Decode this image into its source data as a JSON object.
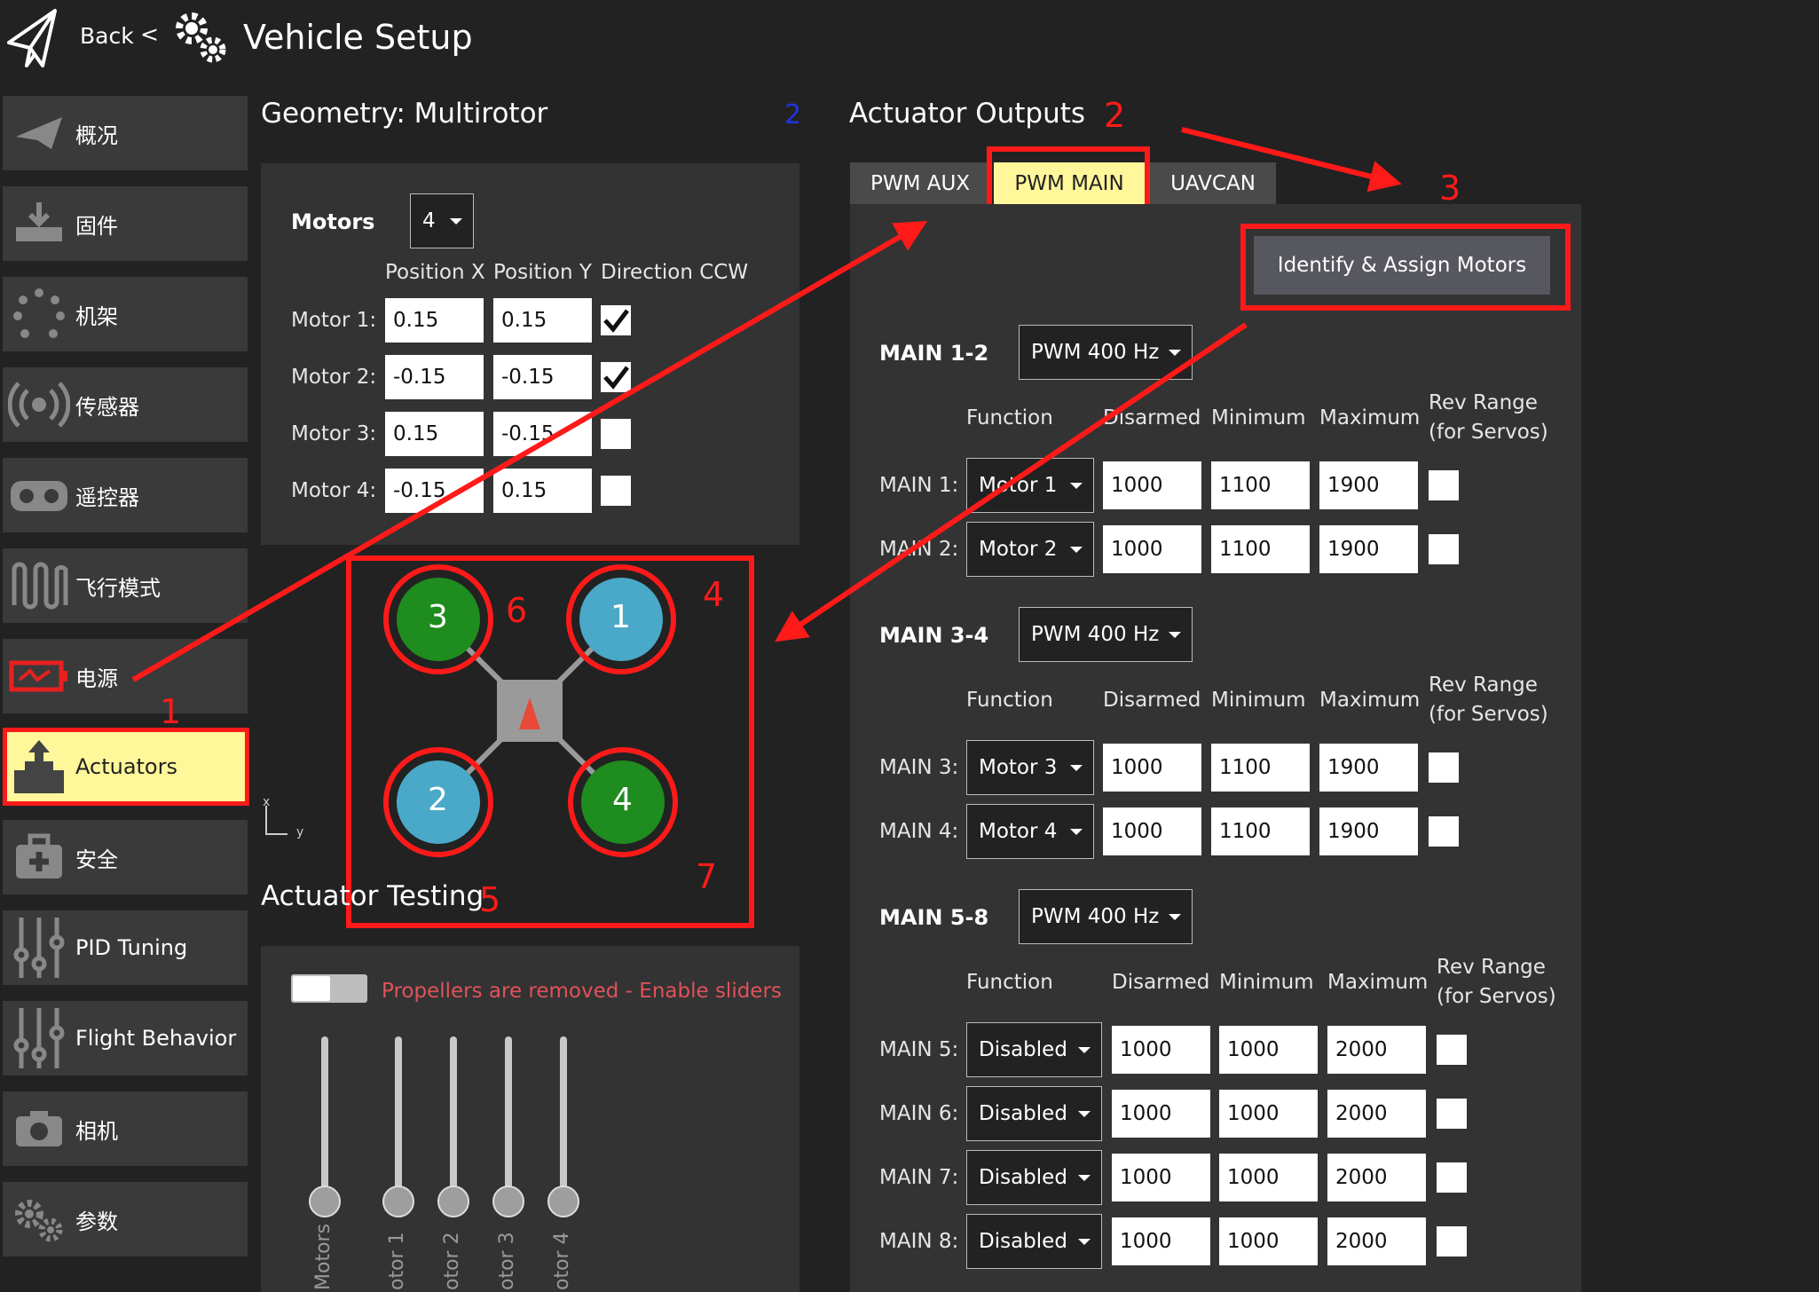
{
  "header": {
    "back_label": "Back",
    "separator": "<",
    "title": "Vehicle Setup"
  },
  "sidebar": {
    "items": [
      {
        "label": "概况",
        "icon": "paper-plane-icon"
      },
      {
        "label": "固件",
        "icon": "download-icon"
      },
      {
        "label": "机架",
        "icon": "airframe-icon"
      },
      {
        "label": "传感器",
        "icon": "radio-waves-icon"
      },
      {
        "label": "遥控器",
        "icon": "radio-controller-icon"
      },
      {
        "label": "飞行模式",
        "icon": "wave-icon"
      },
      {
        "label": "电源",
        "icon": "battery-icon"
      },
      {
        "label": "Actuators",
        "icon": "actuator-icon",
        "active": true
      },
      {
        "label": "安全",
        "icon": "first-aid-icon"
      },
      {
        "label": "PID Tuning",
        "icon": "sliders-icon"
      },
      {
        "label": "Flight Behavior",
        "icon": "sliders-icon"
      },
      {
        "label": "相机",
        "icon": "camera-icon"
      },
      {
        "label": "参数",
        "icon": "gears-icon"
      }
    ]
  },
  "geometry": {
    "title": "Geometry: Multirotor",
    "motors_label": "Motors",
    "motors_value": "4",
    "col_x": "Position X",
    "col_y": "Position Y",
    "col_dir": "Direction CCW",
    "rows": [
      {
        "label": "Motor 1:",
        "x": "0.15",
        "y": "0.15",
        "ccw": true
      },
      {
        "label": "Motor 2:",
        "x": "-0.15",
        "y": "-0.15",
        "ccw": true
      },
      {
        "label": "Motor 3:",
        "x": "0.15",
        "y": "-0.15",
        "ccw": false
      },
      {
        "label": "Motor 4:",
        "x": "-0.15",
        "y": "0.15",
        "ccw": false
      }
    ],
    "diagram": {
      "motor_labels": [
        "3",
        "1",
        "2",
        "4"
      ],
      "axis_x": "x",
      "axis_y": "y"
    }
  },
  "testing": {
    "title": "Actuator Testing",
    "enable_text": "Propellers are removed - Enable sliders",
    "slider_labels": [
      "Motors",
      "otor 1",
      "otor 2",
      "otor 3",
      "otor 4"
    ]
  },
  "outputs": {
    "title": "Actuator Outputs",
    "tabs": [
      "PWM AUX",
      "PWM MAIN",
      "UAVCAN"
    ],
    "active_tab": "PWM MAIN",
    "identify_button": "Identify & Assign Motors",
    "col_function": "Function",
    "col_disarmed": "Disarmed",
    "col_minimum": "Minimum",
    "col_maximum": "Maximum",
    "col_rev": "Rev Range",
    "col_rev2": "(for Servos)",
    "groups": [
      {
        "label": "MAIN 1-2",
        "rate": "PWM 400 Hz",
        "rows": [
          {
            "label": "MAIN 1:",
            "func": "Motor 1",
            "dis": "1000",
            "min": "1100",
            "max": "1900"
          },
          {
            "label": "MAIN 2:",
            "func": "Motor 2",
            "dis": "1000",
            "min": "1100",
            "max": "1900"
          }
        ]
      },
      {
        "label": "MAIN 3-4",
        "rate": "PWM 400 Hz",
        "rows": [
          {
            "label": "MAIN 3:",
            "func": "Motor 3",
            "dis": "1000",
            "min": "1100",
            "max": "1900"
          },
          {
            "label": "MAIN 4:",
            "func": "Motor 4",
            "dis": "1000",
            "min": "1100",
            "max": "1900"
          }
        ]
      },
      {
        "label": "MAIN 5-8",
        "rate": "PWM 400 Hz",
        "rows": [
          {
            "label": "MAIN 5:",
            "func": "Disabled",
            "dis": "1000",
            "min": "1000",
            "max": "2000"
          },
          {
            "label": "MAIN 6:",
            "func": "Disabled",
            "dis": "1000",
            "min": "1000",
            "max": "2000"
          },
          {
            "label": "MAIN 7:",
            "func": "Disabled",
            "dis": "1000",
            "min": "1000",
            "max": "2000"
          },
          {
            "label": "MAIN 8:",
            "func": "Disabled",
            "dis": "1000",
            "min": "1000",
            "max": "2000"
          }
        ]
      }
    ]
  },
  "annotations": {
    "n1": "1",
    "n2": "2",
    "n3": "3",
    "n4": "4",
    "n5": "5",
    "n6": "6",
    "n7": "7",
    "blue2": "2"
  },
  "colors": {
    "accent_yellow": "#fff79a",
    "annotation_red": "#ff1a1a",
    "motor_green": "#1e8c1e",
    "motor_blue": "#4aa8c8",
    "warning_red": "#e0525a"
  }
}
